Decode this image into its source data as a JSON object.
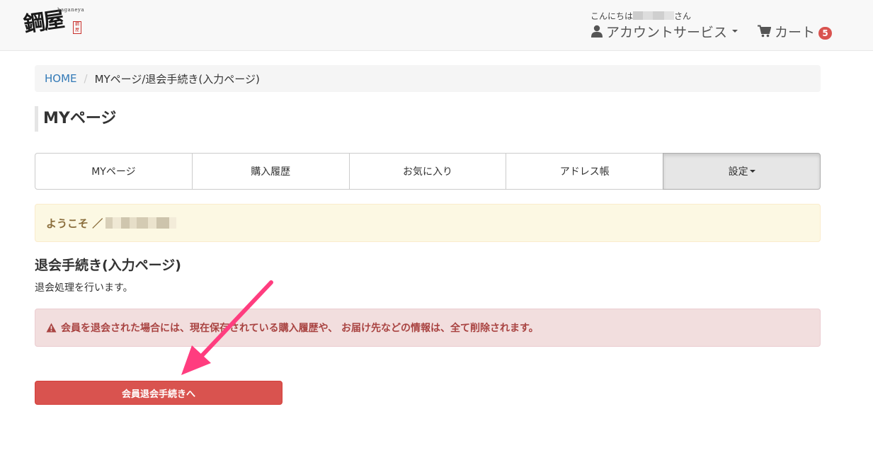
{
  "header": {
    "logo_text": "鋼屋",
    "logo_sub": "haganeya",
    "logo_seal": "鋼屋",
    "greeting_prefix": "こんにちは",
    "greeting_suffix": "さん",
    "account_label": "アカウントサービス",
    "cart_label": "カート",
    "cart_count": "5",
    "icons": [
      "user-icon",
      "cart-icon",
      "chevron-down-icon"
    ]
  },
  "breadcrumb": {
    "home": "HOME",
    "separator": "/",
    "current": "MYページ/退会手続き(入力ページ)"
  },
  "page_title": "MYページ",
  "tabs": [
    {
      "label": "MYページ"
    },
    {
      "label": "購入履歴"
    },
    {
      "label": "お気に入り"
    },
    {
      "label": "アドレス帳"
    },
    {
      "label": "設定",
      "active": true
    }
  ],
  "welcome": {
    "label": "ようこそ ／"
  },
  "section": {
    "title": "退会手続き(入力ページ)",
    "description": "退会処理を行います。"
  },
  "alert": {
    "icon": "warning-icon",
    "text": "会員を退会された場合には、現在保存されている購入履歴や、 お届け先などの情報は、全て削除されます。"
  },
  "button": {
    "label": "会員退会手続きへ"
  },
  "colors": {
    "danger": "#d9534f",
    "warning_bg": "#fcf8e3",
    "alert_bg": "#f2dede",
    "link": "#337ab7",
    "annotation_arrow": "#ff3d7f"
  }
}
